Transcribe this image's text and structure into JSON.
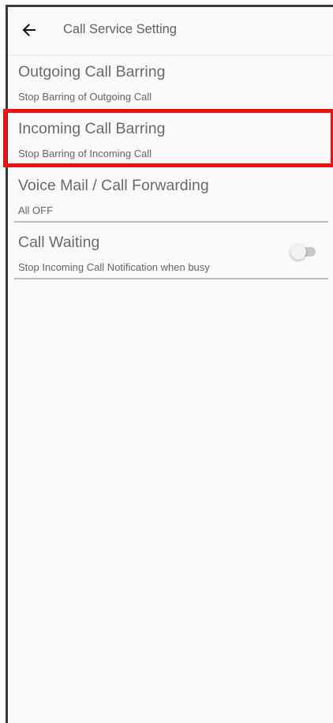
{
  "app_bar": {
    "title": "Call Service Setting",
    "back_icon": "arrow-left-icon"
  },
  "settings": [
    {
      "title": "Outgoing Call Barring",
      "subtitle": "Stop Barring of Outgoing Call"
    },
    {
      "title": "Incoming Call Barring",
      "subtitle": "Stop Barring of Incoming Call",
      "highlighted": true
    },
    {
      "title": "Voice Mail / Call Forwarding",
      "subtitle": "All OFF"
    },
    {
      "title": "Call Waiting",
      "subtitle": "Stop Incoming Call Notification when busy",
      "toggle": {
        "on": false
      }
    }
  ],
  "colors": {
    "highlight": "#ee1111",
    "frame": "#3a3a3a",
    "background": "#fafafa"
  }
}
